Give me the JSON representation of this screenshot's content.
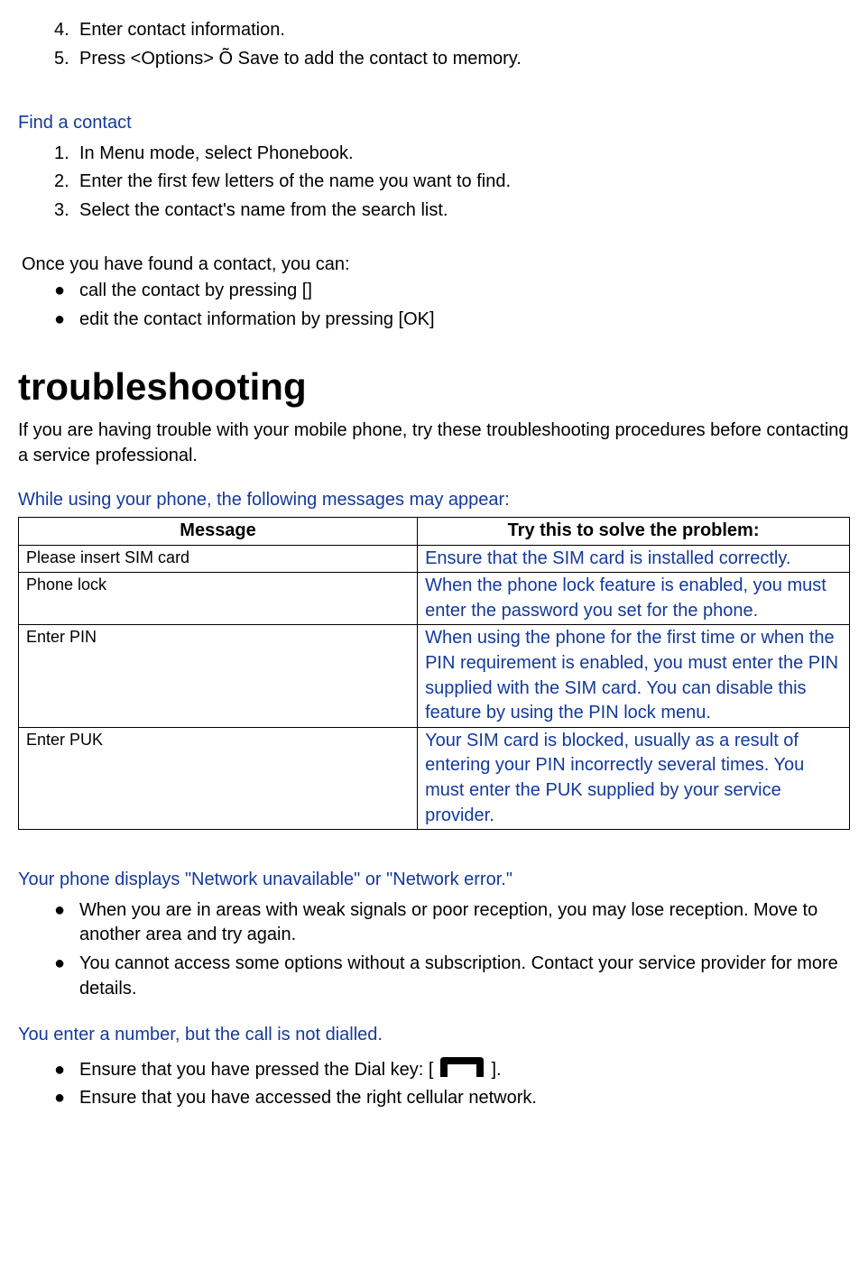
{
  "top_list": [
    {
      "num": "4.",
      "text": "Enter contact information."
    },
    {
      "num": "5.",
      "text": "Press <Options> Õ Save to add the contact to memory."
    }
  ],
  "find_heading": "Find a contact",
  "find_steps": [
    {
      "num": "1.",
      "text": "In Menu mode, select Phonebook."
    },
    {
      "num": "2.",
      "text": "Enter the first few letters of the name you want to find."
    },
    {
      "num": "3.",
      "text": "Select the contact's name from the search list."
    }
  ],
  "found_text": "Once you have found a contact, you can:",
  "found_bullets": [
    "call the contact by pressing []",
    "edit the contact information by pressing [OK]"
  ],
  "ts_title": "troubleshooting",
  "ts_intro": "If you are having trouble with your mobile phone, try these troubleshooting procedures before contacting a service professional.",
  "msg_heading": "While using your phone, the following messages may appear:",
  "table": {
    "head_a": "Message",
    "head_b": "Try this to solve the problem:",
    "rows": [
      {
        "m": "Please insert SIM card",
        "s": "Ensure that the SIM card is installed correctly."
      },
      {
        "m": "Phone lock",
        "s": "When the phone lock feature is enabled, you must enter the password you set for the phone."
      },
      {
        "m": "Enter PIN",
        "s": "When using the phone for the first time or when the PIN requirement is enabled, you must enter the PIN supplied with the SIM card. You can disable this feature by using the PIN lock   menu."
      },
      {
        "m": "Enter PUK",
        "s": "Your SIM card is blocked, usually as a result of entering your PIN incorrectly several times. You must enter the PUK supplied by your service provider."
      }
    ]
  },
  "net_heading": "Your phone displays \"Network unavailable\" or \"Network error.\"",
  "net_bullets": [
    "When you are in areas with weak signals or poor reception, you may lose reception. Move to another area and try again.",
    "You cannot access some options without a subscription. Contact your service provider for more details."
  ],
  "dial_heading": "You enter a number, but the call is not dialled.",
  "dial_b1_a": "Ensure that you have pressed the Dial key: [",
  "dial_b1_b": "].",
  "dial_b2": "Ensure that you have accessed the right cellular network."
}
